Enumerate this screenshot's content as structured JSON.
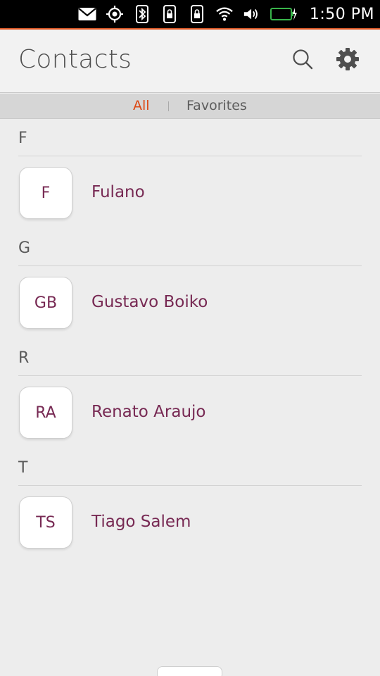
{
  "status_bar": {
    "time": "1:50 PM",
    "icons": [
      "mail-icon",
      "location-icon",
      "bluetooth-icon",
      "sim-lock-icon",
      "sim-lock-icon",
      "wifi-icon",
      "volume-icon",
      "battery-charging-icon"
    ],
    "battery_color": "#38b44a"
  },
  "header": {
    "title": "Contacts",
    "search_icon": "search-icon",
    "settings_icon": "gear-icon"
  },
  "tabs": {
    "all": "All",
    "favorites": "Favorites",
    "active_color": "#dd4814"
  },
  "contacts": {
    "sections": [
      {
        "letter": "F",
        "items": [
          {
            "initials": "F",
            "name": "Fulano"
          }
        ]
      },
      {
        "letter": "G",
        "items": [
          {
            "initials": "GB",
            "name": "Gustavo Boiko"
          }
        ]
      },
      {
        "letter": "R",
        "items": [
          {
            "initials": "RA",
            "name": "Renato Araujo"
          }
        ]
      },
      {
        "letter": "T",
        "items": [
          {
            "initials": "TS",
            "name": "Tiago Salem"
          }
        ]
      }
    ]
  },
  "colors": {
    "accent": "#dd4814",
    "contact_text": "#772953",
    "status_accent": "#e05a28"
  }
}
